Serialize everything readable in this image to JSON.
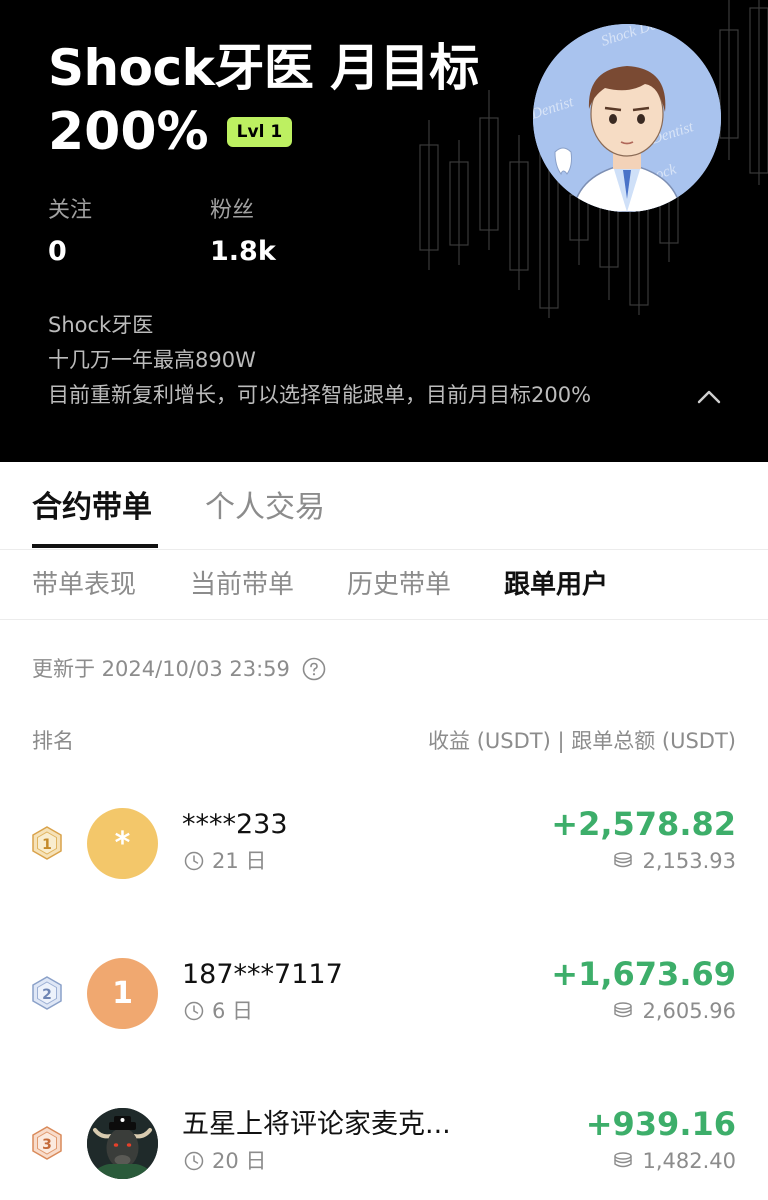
{
  "profile": {
    "title": "Shock牙医 月目标",
    "title_pct": "200%",
    "level": "Lvl 1",
    "stats": [
      {
        "label": "关注",
        "value": "0"
      },
      {
        "label": "粉丝",
        "value": "1.8k"
      }
    ],
    "bio": [
      "Shock牙医",
      "十几万一年最高890W",
      "目前重新复利增长，可以选择智能跟单，目前月目标200%"
    ]
  },
  "main_tabs": [
    {
      "label": "合约带单",
      "active": true
    },
    {
      "label": "个人交易",
      "active": false
    }
  ],
  "sub_tabs": [
    {
      "label": "带单表现",
      "active": false
    },
    {
      "label": "当前带单",
      "active": false
    },
    {
      "label": "历史带单",
      "active": false
    },
    {
      "label": "跟单用户",
      "active": true
    }
  ],
  "updated": "更新于 2024/10/03 23:59",
  "columns": {
    "rank": "排名",
    "right": "收益 (USDT) | 跟单总额 (USDT)"
  },
  "followers": [
    {
      "rank": "1",
      "avatar_text": "*",
      "avatar_color": "#f3c76a",
      "name": "****233",
      "days": "21 日",
      "profit": "+2,578.82",
      "total": "2,153.93"
    },
    {
      "rank": "2",
      "avatar_text": "1",
      "avatar_color": "#f0a870",
      "name": "187***7117",
      "days": "6 日",
      "profit": "+1,673.69",
      "total": "2,605.96"
    },
    {
      "rank": "3",
      "avatar_text": "",
      "avatar_color": "#1f2a2a",
      "name": "五星上将评论家麦克...",
      "days": "20 日",
      "profit": "+939.16",
      "total": "1,482.40"
    }
  ],
  "colors": {
    "profit_green": "#3dae6a",
    "level_badge": "#bdf061",
    "rank_gold": "#d9a24a",
    "rank_silver": "#8aa0c8",
    "rank_bronze": "#d98a5a"
  },
  "icons": [
    "chevron-up-icon",
    "help-circle-icon",
    "clock-icon",
    "coins-icon",
    "rank-badge-icon"
  ]
}
